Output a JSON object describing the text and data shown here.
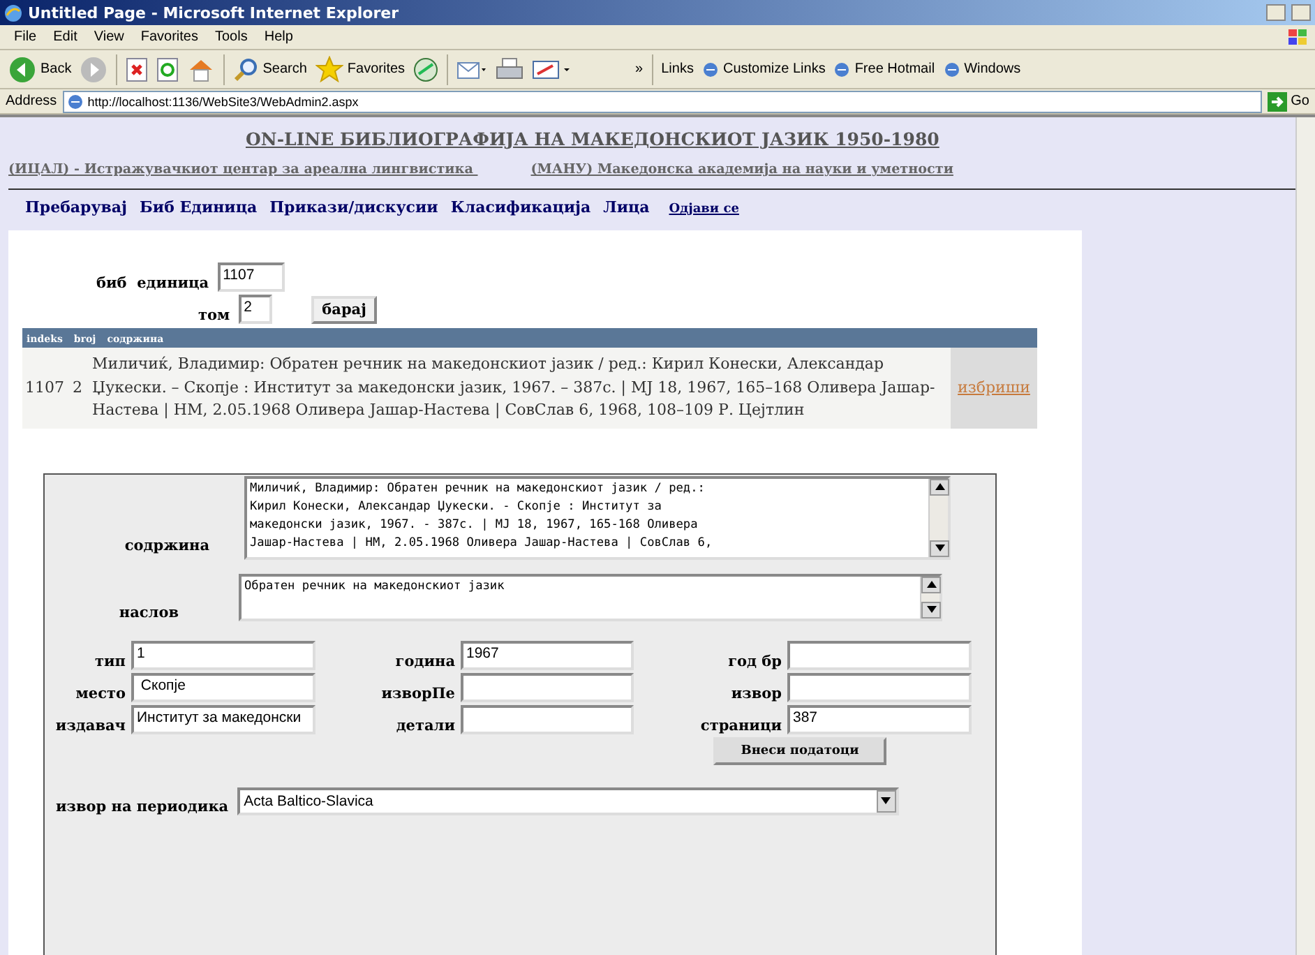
{
  "window": {
    "title": "Untitled Page - Microsoft Internet Explorer"
  },
  "menu": [
    "File",
    "Edit",
    "View",
    "Favorites",
    "Tools",
    "Help"
  ],
  "toolbar": [
    {
      "kind": "back",
      "label": "Back"
    },
    {
      "kind": "forward"
    },
    {
      "kind": "stop"
    },
    {
      "kind": "refresh"
    },
    {
      "kind": "home"
    },
    {
      "kind": "search",
      "label": "Search"
    },
    {
      "kind": "favorites",
      "label": "Favorites"
    },
    {
      "kind": "media"
    },
    {
      "kind": "mail"
    },
    {
      "kind": "print"
    },
    {
      "kind": "edit"
    }
  ],
  "chevron": "»",
  "links": {
    "label": "Links",
    "items": [
      "Customize Links",
      "Free Hotmail",
      "Windows"
    ]
  },
  "address": {
    "label": "Address",
    "value": "http://localhost:1136/WebSite3/WebAdmin2.aspx",
    "go": "Go"
  },
  "page": {
    "title": "ON-LINE БИБЛИОГРАФИЈА НА МАКЕДОНСКИОТ ЈАЗИК 1950-1980",
    "left_link": "(ИЦАЛ) - Истражувачкиот центар за ареална лингвистика ",
    "right_link": "(МАНУ) Македонска академија на науки и уметности",
    "nav": [
      {
        "label": "Пребарувај",
        "kind": "main"
      },
      {
        "label": "Биб Единица",
        "kind": "main"
      },
      {
        "label": "Прикази/дискусии",
        "kind": "main"
      },
      {
        "label": "Класификација",
        "kind": "main"
      },
      {
        "label": "Лица",
        "kind": "main"
      },
      {
        "label": "Одјави се",
        "kind": "small"
      }
    ],
    "search": {
      "unit_label": "биб  единица",
      "unit_value": "1107",
      "volume_label": "том",
      "volume_value": "2",
      "button": "барај"
    },
    "table": {
      "columns": [
        "indeks",
        "broj",
        "содржина"
      ],
      "rows": [
        {
          "indeks": "1107",
          "broj": "2",
          "content": "Миличиќ, Владимир: Обратен речник на македонскиот јазик / ред.: Кирил Конески, Александар Џукески. – Скопје : Институт за македонски јазик, 1967. – 387с. | МЈ 18, 1967, 165–168 Оливера Јашар-Настева | НМ, 2.05.1968 Оливера Јашар-Настева | СовСлав 6, 1968, 108–109 Р. Цејтлин",
          "action": "избриши"
        }
      ]
    },
    "edit": {
      "content_label": "содржина",
      "content_lines": [
        "Миличиќ, Владимир: Обратен речник на македонскиот јазик / ред.:",
        "Кирил Конески, Александар Џукески. - Скопје : Институт за",
        "македонски јазик, 1967. - 387с. | МЈ 18, 1967, 165-168 Оливера",
        "Јашар-Настева | НМ, 2.05.1968 Оливера Јашар-Настева | СовСлав 6,"
      ],
      "title_label": "наслов",
      "title_value": "Обратен речник на македонскиот јазик",
      "fields": [
        {
          "label": "тип",
          "value": "1"
        },
        {
          "label": "година",
          "value": "1967"
        },
        {
          "label": "год бр"
        },
        {
          "label": "место",
          "value": " Скопје"
        },
        {
          "label": "изворПе"
        },
        {
          "label": "извор"
        },
        {
          "label": "издавач",
          "value": "Институт за македонски"
        },
        {
          "label": "детали"
        },
        {
          "label": "страници",
          "value": "387"
        }
      ],
      "submit": "Внеси податоци",
      "periodical_label": "извор на периодика",
      "periodical_value": "Acta Baltico-Slavica"
    }
  }
}
